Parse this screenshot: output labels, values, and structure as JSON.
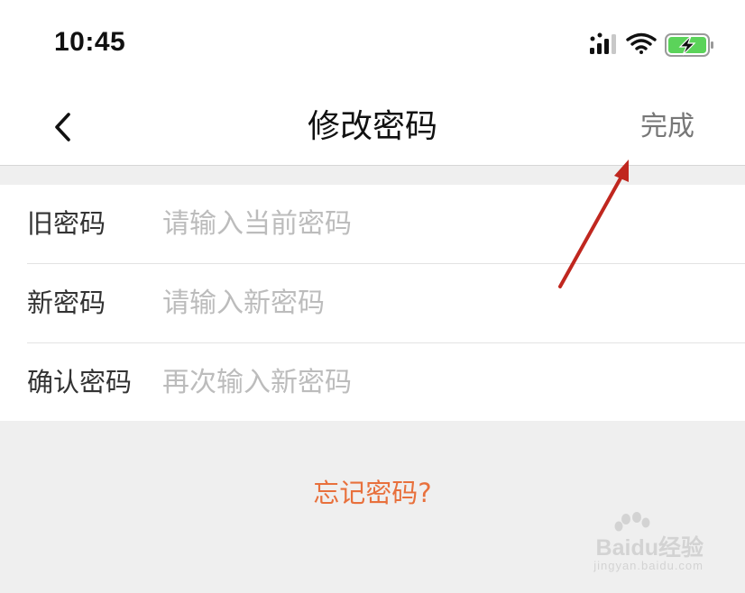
{
  "status_bar": {
    "time": "10:45",
    "icons": [
      "signal-icon",
      "wifi-icon",
      "battery-charging-icon"
    ]
  },
  "nav": {
    "back_icon": "chevron-left-icon",
    "title": "修改密码",
    "done_label": "完成"
  },
  "form": {
    "rows": [
      {
        "label": "旧密码",
        "placeholder": "请输入当前密码",
        "value": ""
      },
      {
        "label": "新密码",
        "placeholder": "请输入新密码",
        "value": ""
      },
      {
        "label": "确认密码",
        "placeholder": "再次输入新密码",
        "value": ""
      }
    ]
  },
  "forgot_link": "忘记密码?",
  "watermark": {
    "brand": "Baidu经验",
    "url": "jingyan.baidu.com"
  },
  "colors": {
    "accent": "#e8703c",
    "annotation_arrow": "#c0271f",
    "placeholder": "#bcbcbc",
    "page_background": "#efefef"
  }
}
